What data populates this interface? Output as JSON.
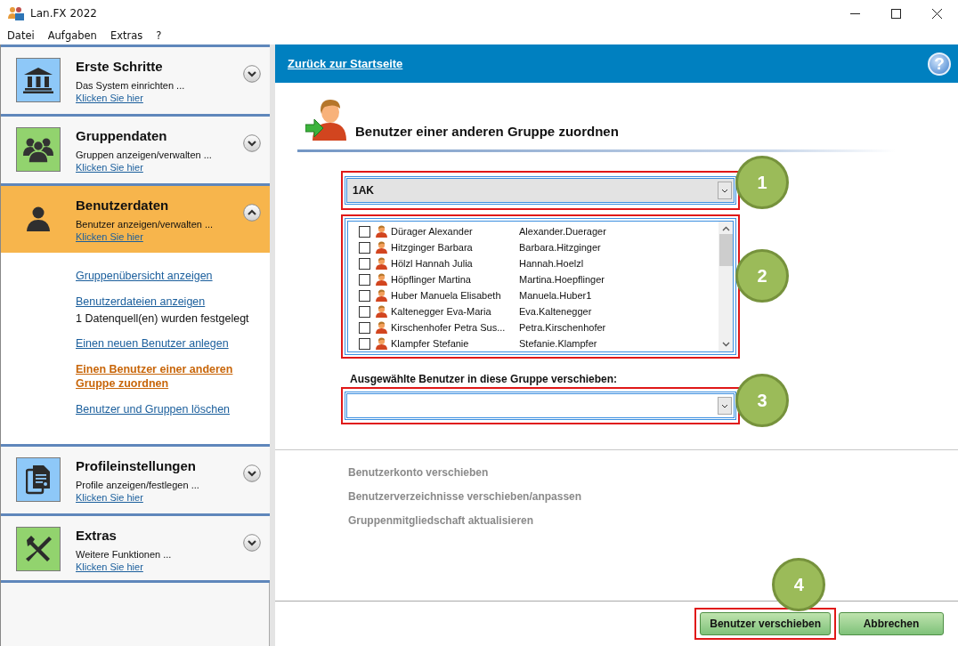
{
  "window": {
    "title": "Lan.FX 2022"
  },
  "menu": [
    {
      "label": "Datei"
    },
    {
      "label": "Aufgaben"
    },
    {
      "label": "Extras"
    },
    {
      "label": "?"
    }
  ],
  "sidebar": {
    "sections": [
      {
        "kind": "bank",
        "title": "Erste Schritte",
        "subtitle": "Das System einrichten ...",
        "link": "Klicken Sie hier",
        "color": "#8ec8f8",
        "expanded": false
      },
      {
        "kind": "group",
        "title": "Gruppendaten",
        "subtitle": "Gruppen anzeigen/verwalten ...",
        "link": "Klicken Sie hier",
        "color": "#92d36e",
        "expanded": false
      },
      {
        "kind": "person",
        "title": "Benutzerdaten",
        "subtitle": "Benutzer anzeigen/verwalten ...",
        "link": "Klicken Sie hier",
        "color": "#f7b54c",
        "expanded": true,
        "links": [
          {
            "label": "Gruppenübersicht anzeigen",
            "selected": false
          },
          {
            "label": "Benutzerdateien anzeigen",
            "selected": false,
            "note": "1 Datenquell(en) wurden festgelegt"
          },
          {
            "label": "Einen neuen Benutzer anlegen",
            "selected": false
          },
          {
            "label": "Einen Benutzer einer anderen Gruppe zuordnen",
            "selected": true
          },
          {
            "label": "Benutzer und Gruppen löschen",
            "selected": false
          }
        ]
      },
      {
        "kind": "document",
        "title": "Profileinstellungen",
        "subtitle": "Profile anzeigen/festlegen ...",
        "link": "Klicken Sie hier",
        "color": "#8ec8f8",
        "expanded": false
      },
      {
        "kind": "tools",
        "title": "Extras",
        "subtitle": "Weitere Funktionen ...",
        "link": "Klicken Sie hier",
        "color": "#92d36e",
        "expanded": false
      }
    ]
  },
  "header": {
    "back_link": "Zurück zur Startseite",
    "help": "?"
  },
  "page": {
    "title": "Benutzer einer anderen Gruppe zuordnen",
    "group_select": {
      "value": "1AK",
      "annotation": "1"
    },
    "user_list": {
      "annotation": "2",
      "users": [
        {
          "name": "Dürager Alexander",
          "login": "Alexander.Duerager",
          "checked": false
        },
        {
          "name": "Hitzginger Barbara",
          "login": "Barbara.Hitzginger",
          "checked": false
        },
        {
          "name": "Hölzl Hannah Julia",
          "login": "Hannah.Hoelzl",
          "checked": false
        },
        {
          "name": "Höpflinger Martina",
          "login": "Martina.Hoepflinger",
          "checked": false
        },
        {
          "name": "Huber Manuela Elisabeth",
          "login": "Manuela.Huber1",
          "checked": false
        },
        {
          "name": "Kaltenegger Eva-Maria",
          "login": "Eva.Kaltenegger",
          "checked": false
        },
        {
          "name": "Kirschenhofer Petra Sus...",
          "login": "Petra.Kirschenhofer",
          "checked": false
        },
        {
          "name": "Klampfer Stefanie",
          "login": "Stefanie.Klampfer",
          "checked": false
        }
      ]
    },
    "target": {
      "label": "Ausgewählte Benutzer in diese Gruppe verschieben:",
      "annotation": "3"
    },
    "steps": [
      {
        "label": "Benutzerkonto verschieben",
        "disabled": true
      },
      {
        "label": "Benutzerverzeichnisse verschieben/anpassen",
        "disabled": true
      },
      {
        "label": "Gruppenmitgliedschaft aktualisieren",
        "disabled": true
      }
    ],
    "buttons": [
      {
        "label": "Benutzer verschieben",
        "annotation": "4"
      },
      {
        "label": "Abbrechen"
      }
    ]
  }
}
